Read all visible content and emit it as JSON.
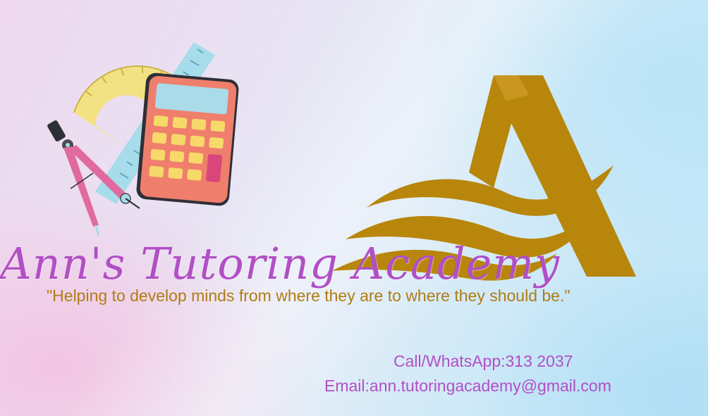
{
  "card": {
    "title": "Ann's Tutoring Academy",
    "tagline": "\"Helping to develop minds from where they are to where they should be.\"",
    "phone": "Call/WhatsApp:313 2037",
    "email": "Email:ann.tutoringacademy@gmail.com"
  },
  "logo": {
    "letter": "A"
  },
  "icons": [
    "calculator-icon",
    "protractor-icon",
    "ruler-icon",
    "compass-icon",
    "logo-a-icon"
  ],
  "colors": {
    "title": "#b14fc6",
    "tagline": "#b07c16",
    "contact": "#b14fc6",
    "logo_gold": "#b8860b",
    "calculator_body": "#ef7f6c",
    "calculator_keys": "#f7d96a",
    "calculator_screen": "#a9dbe9"
  }
}
